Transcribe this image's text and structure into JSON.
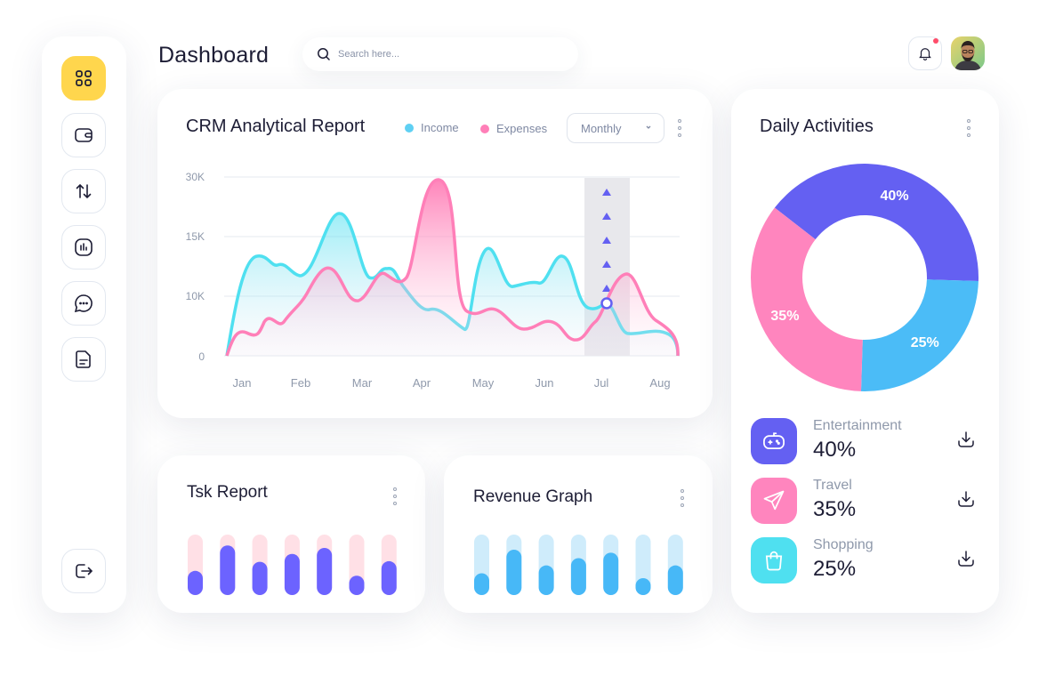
{
  "header": {
    "title": "Dashboard",
    "search_placeholder": "Search here...",
    "notification_icon": "bell-icon",
    "has_unread_notifications": true
  },
  "sidebar": {
    "items": [
      {
        "icon": "grid-icon",
        "active": true
      },
      {
        "icon": "wallet-icon",
        "active": false
      },
      {
        "icon": "transfer-arrows-icon",
        "active": false
      },
      {
        "icon": "bar-chart-icon",
        "active": false
      },
      {
        "icon": "chat-icon",
        "active": false
      },
      {
        "icon": "document-icon",
        "active": false
      }
    ],
    "logout_icon": "logout-icon"
  },
  "crm": {
    "title": "CRM Analytical Report",
    "legend": [
      {
        "name": "Income",
        "color": "#5fd0f3"
      },
      {
        "name": "Expenses",
        "color": "#ff7fb8"
      }
    ],
    "period": "Monthly",
    "highlight_month": "Jul"
  },
  "chart_data": {
    "type": "area",
    "categories": [
      "Jan",
      "Feb",
      "Mar",
      "Apr",
      "May",
      "Jun",
      "Jul",
      "Aug"
    ],
    "y_ticks": [
      "0",
      "10K",
      "15K",
      "30K"
    ],
    "grid": true,
    "series": [
      {
        "name": "Income",
        "color": "#4fe0f0"
      },
      {
        "name": "Expenses",
        "color": "#ff7fb8"
      }
    ]
  },
  "task_report": {
    "title": "Tsk Report",
    "values": [
      0.4,
      0.82,
      0.55,
      0.68,
      0.78,
      0.32,
      0.56
    ],
    "track_color": "#ffe0e6",
    "bar_color": "#6c63ff"
  },
  "revenue_graph": {
    "title": "Revenue Graph",
    "values": [
      0.36,
      0.75,
      0.49,
      0.61,
      0.7,
      0.28,
      0.49
    ],
    "track_color": "#cfecfb",
    "bar_color": "#47b8f7"
  },
  "daily": {
    "title": "Daily Activities",
    "slices": [
      {
        "label": "40%",
        "value": 40,
        "color": "#6460f2"
      },
      {
        "label": "25%",
        "value": 25,
        "color": "#4bbcf7"
      },
      {
        "label": "35%",
        "value": 35,
        "color": "#ff85be"
      }
    ],
    "activities": [
      {
        "name": "Entertainment",
        "value": "40%",
        "icon": "gamepad-icon",
        "color": "#6460f2"
      },
      {
        "name": "Travel",
        "value": "35%",
        "icon": "paper-plane-icon",
        "color": "#ff85be"
      },
      {
        "name": "Shopping",
        "value": "25%",
        "icon": "shopping-bag-icon",
        "color": "#4fe0f0"
      }
    ]
  }
}
